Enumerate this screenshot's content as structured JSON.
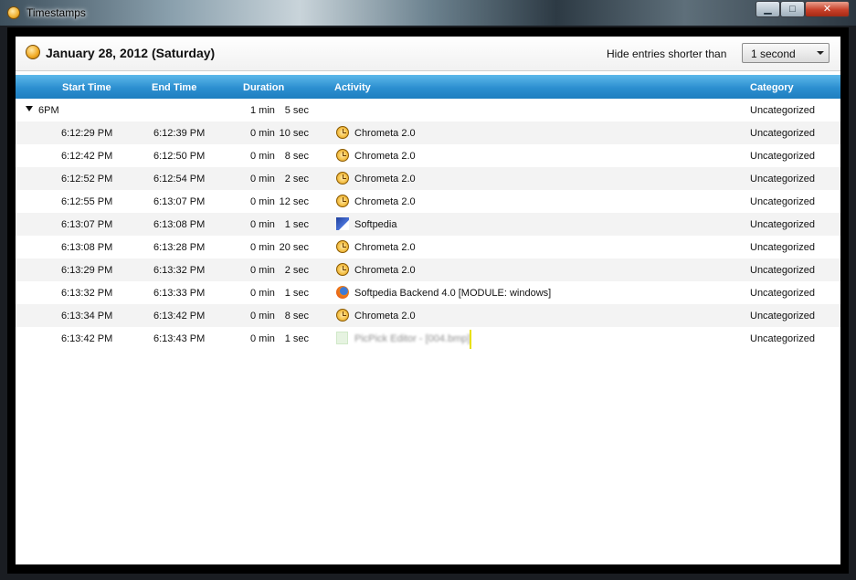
{
  "window": {
    "title": "Timestamps",
    "minimize": "▁",
    "maximize": "□",
    "close": "✕"
  },
  "header": {
    "date": "January 28, 2012 (Saturday)",
    "hide_label": "Hide entries shorter than",
    "hide_value": "1 second"
  },
  "columns": {
    "start": "Start Time",
    "end": "End Time",
    "duration": "Duration",
    "activity": "Activity",
    "category": "Category"
  },
  "group": {
    "label": "6PM",
    "min": "1 min",
    "sec": "5 sec",
    "category": "Uncategorized"
  },
  "rows": [
    {
      "start": "6:12:29 PM",
      "end": "6:12:39 PM",
      "min": "0 min",
      "sec": "10 sec",
      "activity": "Chrometa 2.0",
      "icon": "clock-icon",
      "category": "Uncategorized"
    },
    {
      "start": "6:12:42 PM",
      "end": "6:12:50 PM",
      "min": "0 min",
      "sec": "8 sec",
      "activity": "Chrometa 2.0",
      "icon": "clock-icon",
      "category": "Uncategorized"
    },
    {
      "start": "6:12:52 PM",
      "end": "6:12:54 PM",
      "min": "0 min",
      "sec": "2 sec",
      "activity": "Chrometa 2.0",
      "icon": "clock-icon",
      "category": "Uncategorized"
    },
    {
      "start": "6:12:55 PM",
      "end": "6:13:07 PM",
      "min": "0 min",
      "sec": "12 sec",
      "activity": "Chrometa 2.0",
      "icon": "clock-icon",
      "category": "Uncategorized"
    },
    {
      "start": "6:13:07 PM",
      "end": "6:13:08 PM",
      "min": "0 min",
      "sec": "1 sec",
      "activity": "Softpedia",
      "icon": "softpedia-icon",
      "category": "Uncategorized"
    },
    {
      "start": "6:13:08 PM",
      "end": "6:13:28 PM",
      "min": "0 min",
      "sec": "20 sec",
      "activity": "Chrometa 2.0",
      "icon": "clock-icon",
      "category": "Uncategorized"
    },
    {
      "start": "6:13:29 PM",
      "end": "6:13:32 PM",
      "min": "0 min",
      "sec": "2 sec",
      "activity": "Chrometa 2.0",
      "icon": "clock-icon",
      "category": "Uncategorized"
    },
    {
      "start": "6:13:32 PM",
      "end": "6:13:33 PM",
      "min": "0 min",
      "sec": "1 sec",
      "activity": "Softpedia Backend 4.0 [MODULE: windows]",
      "icon": "firefox-icon",
      "category": "Uncategorized"
    },
    {
      "start": "6:13:34 PM",
      "end": "6:13:42 PM",
      "min": "0 min",
      "sec": "8 sec",
      "activity": "Chrometa 2.0",
      "icon": "clock-icon",
      "category": "Uncategorized"
    },
    {
      "start": "6:13:42 PM",
      "end": "6:13:43 PM",
      "min": "0 min",
      "sec": "1 sec",
      "activity": "PicPick Editor - [004.bmp]",
      "icon": "picpick-icon",
      "category": "Uncategorized"
    }
  ]
}
